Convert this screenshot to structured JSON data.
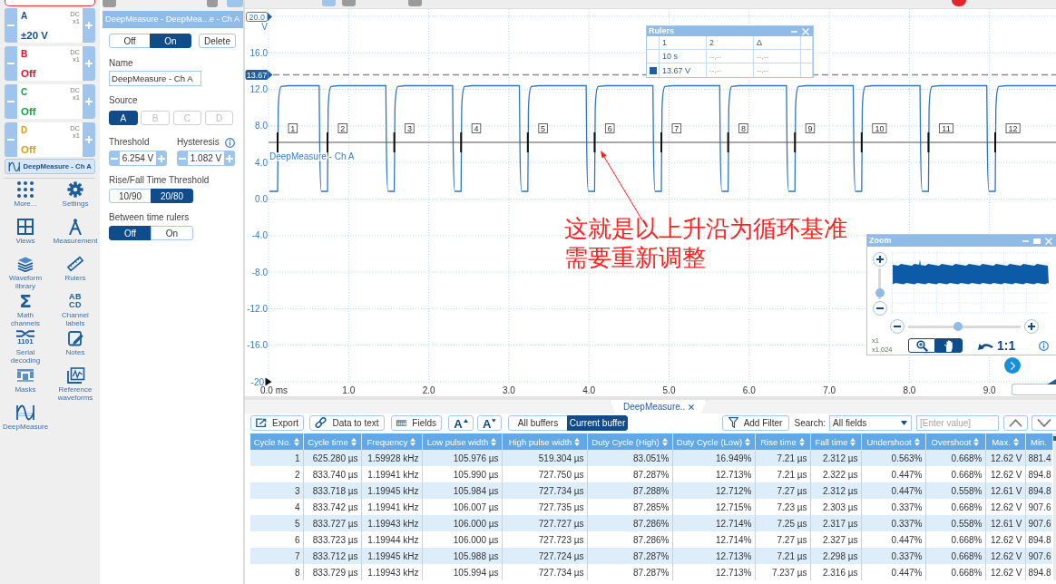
{
  "sidebar": {
    "channels": [
      {
        "letter": "A",
        "coupling": "DC",
        "probe": "x1",
        "range": "±20 V",
        "color": "#1b4f8a"
      },
      {
        "letter": "B",
        "coupling": "DC",
        "probe": "x1",
        "range": "Off",
        "color": "#e8102e"
      },
      {
        "letter": "C",
        "coupling": "DC",
        "probe": "x1",
        "range": "Off",
        "color": "#16a045"
      },
      {
        "letter": "D",
        "coupling": "DC",
        "probe": "x1",
        "range": "Off",
        "color": "#d6a019"
      }
    ],
    "active_measurement": "DeepMeasure - Ch A",
    "tools": [
      {
        "kind": "more",
        "label": "More..."
      },
      {
        "kind": "settings",
        "label": "Settings"
      },
      {
        "kind": "views",
        "label": "Views"
      },
      {
        "kind": "measurements",
        "label": "Measurement"
      },
      {
        "kind": "waveform_library",
        "label": "Waveform library"
      },
      {
        "kind": "rulers",
        "label": "Rulers"
      },
      {
        "kind": "math",
        "label": "Math channels",
        "icon_text": "Σ"
      },
      {
        "kind": "channel_labels",
        "label": "Channel labels",
        "icon_text": "AB CD"
      },
      {
        "kind": "serial",
        "label": "Serial decoding",
        "icon_text": "1101"
      },
      {
        "kind": "notes",
        "label": "Notes"
      },
      {
        "kind": "masks",
        "label": "Masks"
      },
      {
        "kind": "reference",
        "label": "Reference waveforms"
      },
      {
        "kind": "deepmeasure",
        "label": "DeepMeasure"
      }
    ]
  },
  "panel": {
    "title": "DeepMeasure - DeepMea...e - Ch A",
    "state_options": [
      {
        "label": "Off",
        "selected": false
      },
      {
        "label": "On",
        "selected": true
      }
    ],
    "delete_label": "Delete",
    "name_label": "Name",
    "name_value": "DeepMeasure - Ch A",
    "source_label": "Source",
    "sources": [
      {
        "label": "A",
        "selected": true,
        "disabled": false
      },
      {
        "label": "B",
        "selected": false,
        "disabled": true
      },
      {
        "label": "C",
        "selected": false,
        "disabled": true
      },
      {
        "label": "D",
        "selected": false,
        "disabled": true
      }
    ],
    "threshold": {
      "label": "Threshold",
      "value": "6.254 V"
    },
    "hysteresis": {
      "label": "Hysteresis",
      "value": "1.082 V"
    },
    "rise_fall_label": "Rise/Fall Time Threshold",
    "rise_fall_options": [
      {
        "label": "10/90",
        "selected": false
      },
      {
        "label": "20/80",
        "selected": true
      }
    ],
    "between_rulers_label": "Between time rulers",
    "between_rulers_options": [
      {
        "label": "Off",
        "selected": true
      },
      {
        "label": "On",
        "selected": false
      }
    ]
  },
  "scope": {
    "y_axis": {
      "top_label": "20.0",
      "unit": "V",
      "labels": [
        "16.0",
        "12.0",
        "8.0",
        "4.0",
        "0.0",
        "-4.0",
        "-8.0",
        "-12.0",
        "-16.0",
        "-20"
      ]
    },
    "ruler_marker": "13.67",
    "x_axis": {
      "labels": [
        "0.0 ms",
        "1.0",
        "2.0",
        "3.0",
        "4.0",
        "5.0",
        "6.0",
        "7.0",
        "8.0",
        "9.0"
      ]
    },
    "trace_label": "DeepMeasure - Ch A",
    "cycle_numbers": [
      "1",
      "2",
      "3",
      "4",
      "5",
      "6",
      "7",
      "8",
      "9",
      "10",
      "11",
      "12"
    ],
    "rulers": {
      "title": "Rulers",
      "columns": [
        "1",
        "2",
        "Δ"
      ],
      "rows": [
        {
          "kind": "time",
          "cells": [
            "10 s",
            "--,--",
            "--,--"
          ]
        },
        {
          "kind": "voltage",
          "cells": [
            "13.67 V",
            "--,--",
            "--,--"
          ]
        }
      ]
    },
    "zoom": {
      "title": "Zoom",
      "vertical_slider": {
        "level": 0.2
      },
      "horizontal_slider": {
        "level": 0.44
      },
      "scale_labels": [
        "x1",
        "x1,024"
      ],
      "tools": [
        {
          "kind": "zoom",
          "selected": false
        },
        {
          "kind": "pan",
          "selected": true
        }
      ],
      "reset_label": "1:1"
    },
    "annotation": "这就是以上升沿为循环基准需要重新调整"
  },
  "results": {
    "tab_label": "DeepMeasure..",
    "toolbar": {
      "export": "Export",
      "data_to_text": "Data to text",
      "fields": "Fields",
      "font_larger": "A",
      "font_smaller": "A",
      "buffers": [
        {
          "label": "All buffers",
          "selected": false
        },
        {
          "label": "Current buffer",
          "selected": true
        }
      ],
      "add_filter": "Add Filter",
      "search_label": "Search:",
      "search_scope": "All fields",
      "search_placeholder": "[Enter value]"
    },
    "table": {
      "columns": [
        {
          "label": "Cycle No.",
          "sortable": true
        },
        {
          "label": "Cycle time",
          "sortable": true
        },
        {
          "label": "Frequency",
          "sortable": true
        },
        {
          "label": "Low pulse width",
          "sortable": true
        },
        {
          "label": "High pulse width",
          "sortable": true
        },
        {
          "label": "Duty Cycle (High)",
          "sortable": true
        },
        {
          "label": "Duty Cycle (Low)",
          "sortable": true
        },
        {
          "label": "Rise time",
          "sortable": true
        },
        {
          "label": "Fall time",
          "sortable": true
        },
        {
          "label": "Undershoot",
          "sortable": true
        },
        {
          "label": "Overshoot",
          "sortable": true
        },
        {
          "label": "Max.",
          "sortable": true
        },
        {
          "label": "Min.",
          "sortable": false
        }
      ],
      "rows": [
        [
          "1",
          "625.280 µs",
          "1.59928 kHz",
          "105.976 µs",
          "519.304 µs",
          "83.051%",
          "16.949%",
          "7.21 µs",
          "2.312 µs",
          "0.563%",
          "0.668%",
          "12.62 V",
          "881.4"
        ],
        [
          "2",
          "833.740 µs",
          "1.19941 kHz",
          "105.990 µs",
          "727.750 µs",
          "87.287%",
          "12.713%",
          "7.21 µs",
          "2.322 µs",
          "0.447%",
          "0.668%",
          "12.62 V",
          "894.8"
        ],
        [
          "3",
          "833.718 µs",
          "1.19945 kHz",
          "105.984 µs",
          "727.734 µs",
          "87.288%",
          "12.712%",
          "7.27 µs",
          "2.312 µs",
          "0.447%",
          "0.558%",
          "12.61 V",
          "894.8"
        ],
        [
          "4",
          "833.742 µs",
          "1.19941 kHz",
          "106.007 µs",
          "727.735 µs",
          "87.285%",
          "12.715%",
          "7.23 µs",
          "2.303 µs",
          "0.337%",
          "0.668%",
          "12.62 V",
          "907.6"
        ],
        [
          "5",
          "833.727 µs",
          "1.19943 kHz",
          "106.000 µs",
          "727.727 µs",
          "87.286%",
          "12.714%",
          "7.25 µs",
          "2.317 µs",
          "0.337%",
          "0.558%",
          "12.61 V",
          "907.6"
        ],
        [
          "6",
          "833.723 µs",
          "1.19944 kHz",
          "106.000 µs",
          "727.723 µs",
          "87.286%",
          "12.714%",
          "7.27 µs",
          "2.327 µs",
          "0.447%",
          "0.668%",
          "12.62 V",
          "894.8"
        ],
        [
          "7",
          "833.712 µs",
          "1.19945 kHz",
          "105.988 µs",
          "727.724 µs",
          "87.287%",
          "12.713%",
          "7.21 µs",
          "2.298 µs",
          "0.337%",
          "0.668%",
          "12.62 V",
          "907.6"
        ],
        [
          "8",
          "833.729 µs",
          "1.19943 kHz",
          "105.994 µs",
          "727.734 µs",
          "87.287%",
          "12.713%",
          "7.237 µs",
          "2.316 µs",
          "0.447%",
          "0.668%",
          "12.62 V",
          "894.8"
        ]
      ]
    }
  }
}
